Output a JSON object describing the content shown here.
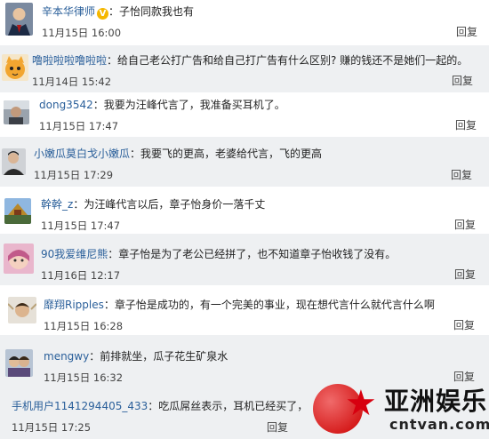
{
  "comments": [
    {
      "user": "辛本华律师",
      "verified": "V",
      "sep": "：",
      "text": "子怡同款我也有",
      "time": "11月15日 16:00",
      "reply": "回复"
    },
    {
      "user": "噜啦啦啦噜啦啦",
      "sep": "：",
      "text": "给自己老公打广告和给自己打广告有什么区别? 赚的钱还不是她们一起的。",
      "time": "11月14日 15:42",
      "reply": "回复"
    },
    {
      "user": "dong3542",
      "sep": "：",
      "text": "我要为汪峰代言了，我准备买耳机了。",
      "time": "11月15日 17:47",
      "reply": "回复"
    },
    {
      "user": "小嫩瓜莫白戈小嫩瓜",
      "sep": "：",
      "text": "我要飞的更高，老婆给代言，飞的更高",
      "time": "11月15日 17:29",
      "reply": "回复"
    },
    {
      "user": "幹幹_z",
      "sep": "：",
      "text": "为汪峰代言以后，章子怡身价一落千丈",
      "time": "11月15日 17:47",
      "reply": "回复"
    },
    {
      "user": "90我爱维尼熊",
      "sep": "：",
      "text": "章子怡是为了老公已经拼了，也不知道章子怡收钱了没有。",
      "time": "11月16日 12:17",
      "reply": "回复"
    },
    {
      "user": "靡翔Ripples",
      "sep": "：",
      "text": "章子怡是成功的，有一个完美的事业，现在想代言什么就代言什么啊",
      "time": "11月15日 16:28",
      "reply": "回复"
    },
    {
      "user": "mengwy",
      "sep": "：",
      "text": "前排就坐，瓜子花生矿泉水",
      "time": "11月15日 16:32",
      "reply": "回复"
    },
    {
      "user": "手机用户1141294405_433",
      "sep": "：",
      "text": "吃瓜屌丝表示，耳机已经买了，",
      "time": "11月15日 17:25",
      "reply": "回复"
    }
  ],
  "watermark": {
    "title": "亚洲娱乐",
    "url": "cntvan.com"
  },
  "colors": {
    "name_link": "#2a5f9a",
    "gray_strip": "#eef0f2",
    "verified_badge": "#f5b700",
    "watermark_red": "#d7000f"
  }
}
